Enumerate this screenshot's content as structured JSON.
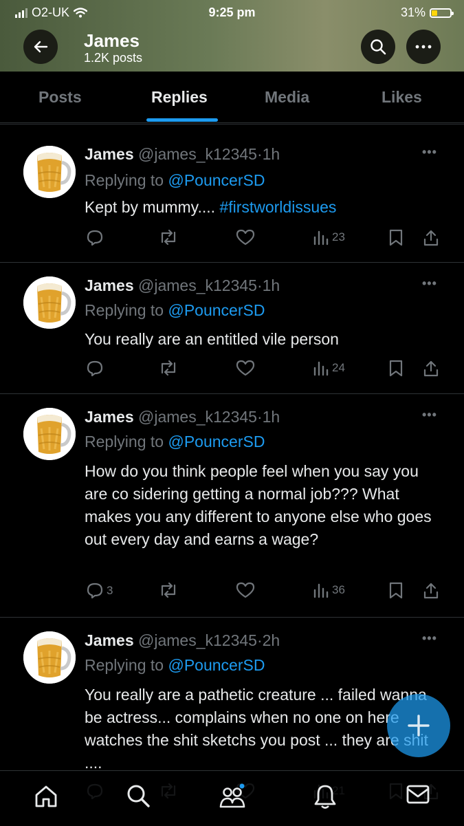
{
  "status_bar": {
    "carrier": "O2-UK",
    "time": "9:25 pm",
    "battery": "31%",
    "battery_level": 0.31,
    "icons": [
      "signal-icon",
      "wifi-icon",
      "battery-icon"
    ]
  },
  "header": {
    "title": "James",
    "subtitle": "1.2K posts",
    "icons": [
      "back-arrow-icon",
      "search-icon",
      "more-icon"
    ]
  },
  "tabs": [
    {
      "label": "Posts",
      "active": false
    },
    {
      "label": "Replies",
      "active": true
    },
    {
      "label": "Media",
      "active": false
    },
    {
      "label": "Likes",
      "active": false
    }
  ],
  "posts": [
    {
      "name": "James",
      "handle": "@james_k12345",
      "sep": "·",
      "time": "1h",
      "replying_prefix": "Replying to ",
      "replying_to": "@PouncerSD",
      "text": "Kept by mummy.... ",
      "hashtag": "#firstworldissues",
      "reply_count": "",
      "views": "23"
    },
    {
      "name": "James",
      "handle": "@james_k12345",
      "sep": "·",
      "time": "1h",
      "replying_prefix": "Replying to ",
      "replying_to": "@PouncerSD",
      "text": "You really are an entitled vile person",
      "reply_count": "",
      "views": "24"
    },
    {
      "name": "James",
      "handle": "@james_k12345",
      "sep": "·",
      "time": "1h",
      "replying_prefix": "Replying to ",
      "replying_to": "@PouncerSD",
      "text": "How do you think people feel when you say you are co sidering getting a normal job??? What makes you any different to anyone else who goes out every day and earns a wage?",
      "reply_count": "3",
      "views": "36"
    },
    {
      "name": "James",
      "handle": "@james_k12345",
      "sep": "·",
      "time": "2h",
      "replying_prefix": "Replying to ",
      "replying_to": "@PouncerSD",
      "text": "You really are a pathetic creature ... failed wanna be actress... complains when no one on here watches the shit sketchs you post ... they are shit ....",
      "reply_count": "",
      "views": "21"
    }
  ],
  "action_icons": [
    "reply-icon",
    "repost-icon",
    "like-icon",
    "views-icon",
    "bookmark-icon",
    "share-icon"
  ],
  "tab_bar": [
    "home-icon",
    "search-icon",
    "communities-icon",
    "notifications-icon",
    "messages-icon"
  ],
  "fab": "compose-plus-icon",
  "colors": {
    "accent": "#1d9bf0",
    "muted": "#71767b",
    "text": "#e7e9ea",
    "background": "#000000"
  }
}
